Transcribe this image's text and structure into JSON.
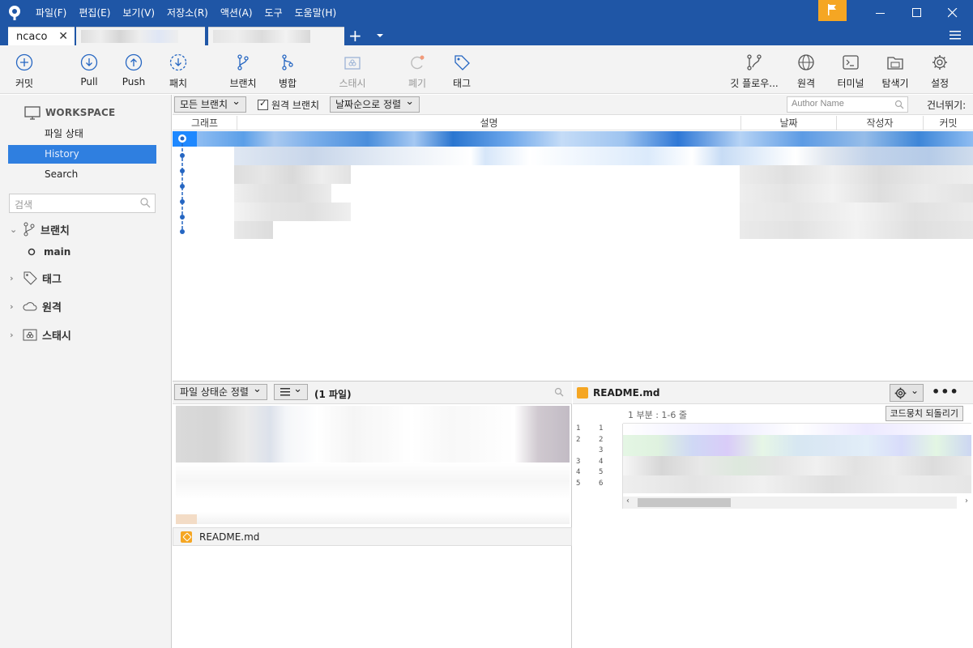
{
  "window": {
    "menu": [
      "파일(F)",
      "편집(E)",
      "보기(V)",
      "저장소(R)",
      "액션(A)",
      "도구",
      "도움말(H)"
    ]
  },
  "tabs": {
    "active": "ncaco"
  },
  "toolbar": {
    "commit": "커밋",
    "pull": "Pull",
    "push": "Push",
    "fetch": "패치",
    "branch": "브랜치",
    "merge": "병합",
    "stash": "스태시",
    "discard": "폐기",
    "tag": "태그",
    "gitflow": "깃 플로우...",
    "remote": "원격",
    "terminal": "터미널",
    "explorer": "탐색기",
    "settings": "설정"
  },
  "sidebar": {
    "workspace": "WORKSPACE",
    "items": [
      "파일 상태",
      "History",
      "Search"
    ],
    "selected": "History",
    "search_placeholder": "검색",
    "branches": "브랜치",
    "current_branch": "main",
    "tags": "태그",
    "remotes": "원격",
    "stashes": "스태시"
  },
  "history": {
    "branch_filter": "모든 브랜치",
    "show_remote": "원격 브랜치",
    "sort": "날짜순으로 정렬",
    "author_placeholder": "Author Name",
    "jump_to": "건너뛰기:",
    "columns": [
      "그래프",
      "설명",
      "날짜",
      "작성자",
      "커밋"
    ]
  },
  "files": {
    "sort": "파일 상태순 정렬",
    "count": "(1 파일)",
    "name": "README.md"
  },
  "diff": {
    "file": "README.md",
    "hunk": "1 부분 : 1-6 줄",
    "discard_hunk": "코드뭉치 되돌리기",
    "lines": [
      [
        "1",
        "1"
      ],
      [
        "2",
        "2"
      ],
      [
        "",
        "3"
      ],
      [
        "3",
        "4"
      ],
      [
        "4",
        "5"
      ],
      [
        "5",
        "6"
      ]
    ]
  },
  "colors": {
    "accent": "#1f56a6",
    "selection": "#2f7fe0",
    "warning": "#f5a623"
  }
}
